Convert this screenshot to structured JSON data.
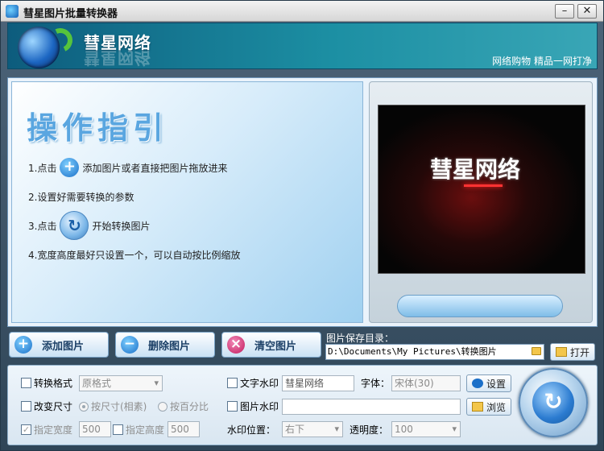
{
  "window": {
    "title": "彗星图片批量转换器",
    "minimize_glyph": "–",
    "close_glyph": "✕"
  },
  "banner": {
    "brand": "彗星网络",
    "slogan": "网络购物 精品一网打净"
  },
  "guide": {
    "title": "操作指引",
    "step1_pre": "1.点击",
    "step1_post": "添加图片或者直接把图片拖放进来",
    "step2": "2.设置好需要转换的参数",
    "step3_pre": "3.点击",
    "step3_post": "开始转换图片",
    "step4": "4.宽度高度最好只设置一个，可以自动按比例缩放"
  },
  "preview": {
    "screen_text": "彗星网络"
  },
  "actions": {
    "add": "添加图片",
    "delete": "删除图片",
    "clear": "清空图片"
  },
  "save": {
    "label": "图片保存目录：",
    "path": "D:\\Documents\\My Pictures\\转换图片",
    "open": "打开"
  },
  "settings": {
    "convert_format_label": "转换格式",
    "convert_format_value": "原格式",
    "resize_label": "改变尺寸",
    "by_size_label": "按尺寸(相素)",
    "by_percent_label": "按百分比",
    "width_label": "指定宽度",
    "width_value": "500",
    "height_label": "指定高度",
    "height_value": "500",
    "text_watermark_label": "文字水印",
    "text_watermark_value": "彗星网络",
    "font_label": "字体：",
    "font_value": "宋体(30)",
    "setup_button": "设置",
    "image_watermark_label": "图片水印",
    "image_watermark_value": "",
    "browse_button": "浏览",
    "watermark_pos_label": "水印位置：",
    "watermark_pos_value": "右下",
    "opacity_label": "透明度：",
    "opacity_value": "100"
  },
  "colors": {
    "banner": "#1c8fa3",
    "accent": "#1a6fc8",
    "clear_icon": "#c2185b"
  }
}
